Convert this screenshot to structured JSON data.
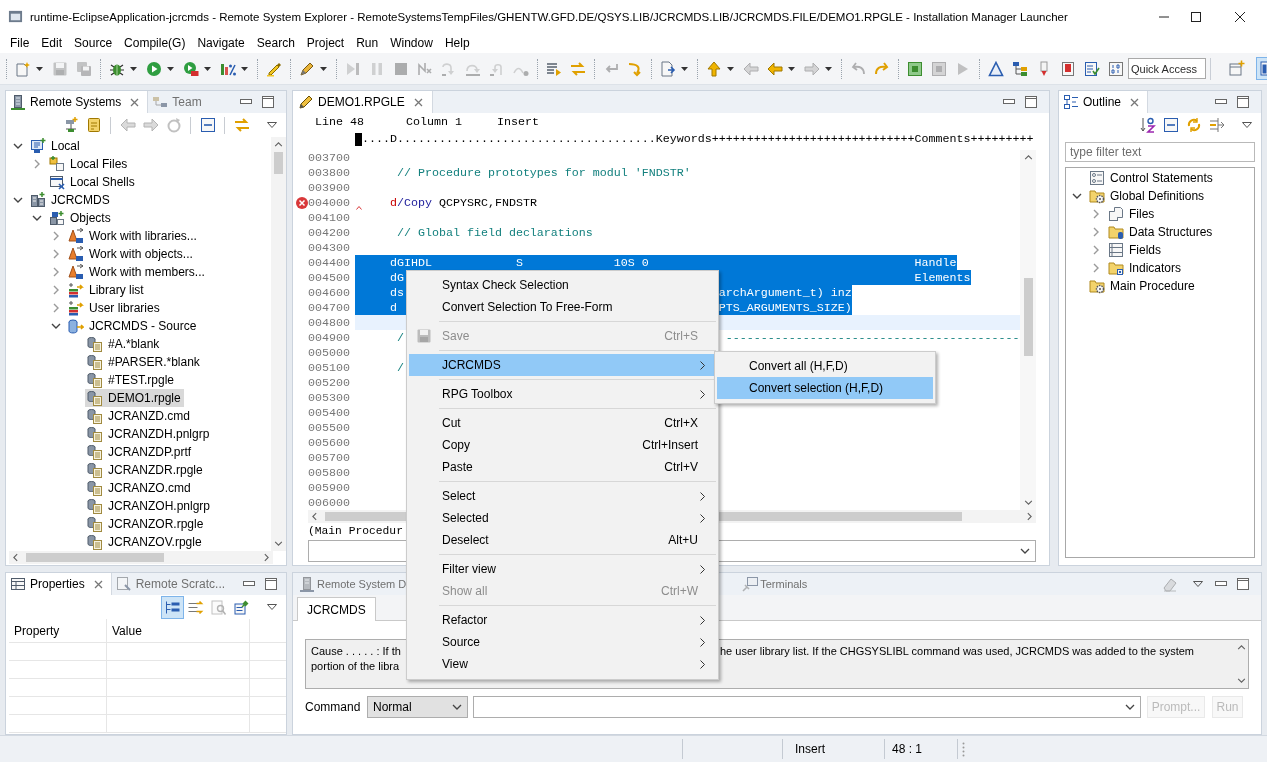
{
  "window": {
    "title": "runtime-EclipseApplication-jcrcmds - Remote System Explorer - RemoteSystemsTempFiles/GHENTW.GFD.DE/QSYS.LIB/JCRCMDS.LIB/JCRCMDS.FILE/DEMO1.RPGLE - Installation Manager Launcher"
  },
  "menu_bar": [
    "File",
    "Edit",
    "Source",
    "Compile(G)",
    "Navigate",
    "Search",
    "Project",
    "Run",
    "Window",
    "Help"
  ],
  "toolbar": {
    "groups": [
      [
        {
          "kind": "new",
          "disabled": false,
          "dropdown": true
        },
        {
          "kind": "floppy",
          "disabled": true,
          "dropdown": false
        },
        {
          "kind": "floppies",
          "disabled": true,
          "dropdown": false
        }
      ],
      [
        {
          "kind": "bug",
          "disabled": false,
          "dropdown": true
        },
        {
          "kind": "run",
          "disabled": false,
          "dropdown": true
        },
        {
          "kind": "external",
          "disabled": false,
          "dropdown": true
        },
        {
          "kind": "coverage",
          "disabled": false,
          "dropdown": true
        }
      ],
      [
        {
          "kind": "highlighter",
          "disabled": false,
          "dropdown": false
        }
      ],
      [
        {
          "kind": "pen",
          "disabled": false,
          "dropdown": true
        }
      ],
      [
        {
          "kind": "resume",
          "disabled": true,
          "dropdown": false
        },
        {
          "kind": "suspend",
          "disabled": true,
          "dropdown": false
        },
        {
          "kind": "terminate",
          "disabled": true,
          "dropdown": false
        },
        {
          "kind": "disconnect",
          "disabled": true,
          "dropdown": false
        },
        {
          "kind": "step-into",
          "disabled": true,
          "dropdown": false
        },
        {
          "kind": "step-over",
          "disabled": true,
          "dropdown": false
        },
        {
          "kind": "step-return",
          "disabled": true,
          "dropdown": false
        },
        {
          "kind": "step-filter",
          "disabled": true,
          "dropdown": false
        }
      ],
      [
        {
          "kind": "lines",
          "disabled": false,
          "dropdown": false
        },
        {
          "kind": "swap",
          "disabled": false,
          "dropdown": false
        }
      ],
      [
        {
          "kind": "return",
          "disabled": true,
          "dropdown": false
        },
        {
          "kind": "curve",
          "disabled": false,
          "dropdown": false
        }
      ],
      [
        {
          "kind": "doc-arrow",
          "disabled": false,
          "dropdown": true
        }
      ],
      [
        {
          "kind": "up",
          "disabled": false,
          "dropdown": true
        },
        {
          "kind": "back",
          "disabled": true,
          "dropdown": false
        },
        {
          "kind": "left",
          "disabled": false,
          "dropdown": true
        },
        {
          "kind": "right",
          "disabled": true,
          "dropdown": true
        }
      ],
      [
        {
          "kind": "undo",
          "disabled": true,
          "dropdown": false
        },
        {
          "kind": "redo",
          "disabled": false,
          "dropdown": false
        }
      ],
      [
        {
          "kind": "square-dot",
          "disabled": false,
          "dropdown": false
        },
        {
          "kind": "square",
          "disabled": true,
          "dropdown": false
        },
        {
          "kind": "play",
          "disabled": true,
          "dropdown": false
        }
      ],
      [
        {
          "kind": "triangle",
          "disabled": false,
          "dropdown": false
        },
        {
          "kind": "hierarchy",
          "disabled": false,
          "dropdown": false
        },
        {
          "kind": "marker",
          "disabled": false,
          "dropdown": false
        },
        {
          "kind": "flag-doc",
          "disabled": false,
          "dropdown": false
        },
        {
          "kind": "checklist",
          "disabled": false,
          "dropdown": false
        },
        {
          "kind": "binary",
          "disabled": false,
          "dropdown": false
        }
      ]
    ],
    "quick_access": {
      "placeholder": "Quick Access"
    },
    "perspectives": [
      {
        "kind": "open-perspective",
        "selected": false
      },
      {
        "kind": "rse-perspective",
        "selected": true
      }
    ]
  },
  "remote_systems": {
    "tabs": [
      {
        "label": "Remote Systems",
        "kind": "remote-systems",
        "selected": true
      },
      {
        "label": "Team",
        "kind": "team",
        "selected": false
      }
    ],
    "toolbar": [
      {
        "kind": "new-connection",
        "disabled": false
      },
      {
        "kind": "clipboard",
        "disabled": false
      },
      {
        "kind": "separator"
      },
      {
        "kind": "back",
        "disabled": true
      },
      {
        "kind": "right",
        "disabled": true
      },
      {
        "kind": "refresh",
        "disabled": true
      },
      {
        "kind": "separator"
      },
      {
        "kind": "collapse-all",
        "disabled": false
      },
      {
        "kind": "separator"
      },
      {
        "kind": "swap",
        "disabled": false
      }
    ],
    "tree": [
      {
        "label": "Local",
        "kind": "host",
        "expanded": true,
        "selected": false,
        "children": [
          {
            "label": "Local Files",
            "kind": "local-files",
            "expanded": false,
            "selected": false
          },
          {
            "label": "Local Shells",
            "kind": "local-shells",
            "selected": false
          }
        ]
      },
      {
        "label": "JCRCMDS",
        "kind": "system",
        "expanded": true,
        "selected": false,
        "children": [
          {
            "label": "Objects",
            "kind": "objects",
            "expanded": true,
            "selected": false,
            "children": [
              {
                "label": "Work with libraries...",
                "kind": "filter",
                "expanded": false,
                "selected": false
              },
              {
                "label": "Work with objects...",
                "kind": "filter",
                "expanded": false,
                "selected": false
              },
              {
                "label": "Work with members...",
                "kind": "filter",
                "expanded": false,
                "selected": false
              },
              {
                "label": "Library list",
                "kind": "library-list",
                "expanded": false,
                "selected": false
              },
              {
                "label": "User libraries",
                "kind": "library-list",
                "expanded": false,
                "selected": false
              },
              {
                "label": "JCRCMDS - Source",
                "kind": "source-file",
                "expanded": true,
                "selected": false,
                "children": [
                  {
                    "label": "#A.*blank",
                    "kind": "member",
                    "selected": false
                  },
                  {
                    "label": "#PARSER.*blank",
                    "kind": "member",
                    "selected": false
                  },
                  {
                    "label": "#TEST.rpgle",
                    "kind": "member",
                    "selected": false
                  },
                  {
                    "label": "DEMO1.rpgle",
                    "kind": "member",
                    "selected": true
                  },
                  {
                    "label": "JCRANZD.cmd",
                    "kind": "member",
                    "selected": false
                  },
                  {
                    "label": "JCRANZDH.pnlgrp",
                    "kind": "member",
                    "selected": false
                  },
                  {
                    "label": "JCRANZDP.prtf",
                    "kind": "member",
                    "selected": false
                  },
                  {
                    "label": "JCRANZDR.rpgle",
                    "kind": "member",
                    "selected": false
                  },
                  {
                    "label": "JCRANZO.cmd",
                    "kind": "member",
                    "selected": false
                  },
                  {
                    "label": "JCRANZOH.pnlgrp",
                    "kind": "member",
                    "selected": false
                  },
                  {
                    "label": "JCRANZOR.rpgle",
                    "kind": "member",
                    "selected": false
                  },
                  {
                    "label": "JCRANZOV.rpgle",
                    "kind": "member",
                    "selected": false
                  }
                ]
              }
            ]
          }
        ]
      }
    ]
  },
  "editor": {
    "tabs": [
      {
        "label": "DEMO1.RPGLE",
        "kind": "editor",
        "selected": true
      }
    ],
    "status": [
      "Line 48",
      "Column 1",
      "Insert"
    ],
    "ruler": {
      "cursor": true,
      "text": "....D.....................................Keywords+++++++++++++++++++++++++++++Comments+++++++++"
    },
    "lines": [
      {
        "number": "003700",
        "selected": false,
        "current": false,
        "error": false
      },
      {
        "number": "003800",
        "selected": false,
        "current": false,
        "error": false,
        "segments": [
          [
            {
              "text": "      // Procedure prototypes for modul 'FNDSTR'",
              "kind": "comment"
            }
          ]
        ]
      },
      {
        "number": "003900",
        "selected": false,
        "current": false,
        "error": false
      },
      {
        "number": "004000",
        "selected": false,
        "current": false,
        "error": true,
        "segments": [
          [
            {
              "text": "     d",
              "kind": "spec"
            },
            {
              "text": "/Copy",
              "kind": "keyword"
            },
            {
              "text": " QCPYSRC,FNDSTR",
              "kind": "plain"
            }
          ]
        ]
      },
      {
        "number": "004100",
        "selected": false,
        "current": false,
        "error": false
      },
      {
        "number": "004200",
        "selected": false,
        "current": false,
        "error": false,
        "segments": [
          [
            {
              "text": "      // Global field declarations",
              "kind": "comment"
            }
          ]
        ]
      },
      {
        "number": "004300",
        "selected": false,
        "current": false,
        "error": false
      },
      {
        "number": "004400",
        "selected": true,
        "current": false,
        "error": false,
        "segments": [
          [
            {
              "text": "     dGIHDL            S             10S 0                                      Handle"
            }
          ]
        ]
      },
      {
        "number": "004500",
        "selected": true,
        "current": false,
        "error": false,
        "segments": [
          [
            {
              "text": "     dG"
            }
          ],
          [
            {
              "text": "                                                                         Elements"
            }
          ]
        ]
      },
      {
        "number": "004600",
        "selected": true,
        "current": false,
        "error": false,
        "segments": [
          [
            {
              "text": "     ds"
            }
          ],
          [
            {
              "text": "                                             archArgument_t) inz"
            }
          ]
        ]
      },
      {
        "number": "004700",
        "selected": true,
        "current": false,
        "error": false,
        "segments": [
          [
            {
              "text": "     d"
            }
          ],
          [
            {
              "text": "                                              PTS_ARGUMENTS_SIZE)"
            }
          ]
        ]
      },
      {
        "number": "004800",
        "selected": false,
        "current": true,
        "error": false
      },
      {
        "number": "004900",
        "selected": false,
        "current": false,
        "error": false,
        "segments": [
          [
            {
              "text": "      /",
              "kind": "comment"
            }
          ],
          [
            {
              "text": "                                              ------------------------------------------",
              "kind": "comment"
            }
          ]
        ]
      },
      {
        "number": "005000",
        "selected": false,
        "current": false,
        "error": false
      },
      {
        "number": "005100",
        "selected": false,
        "current": false,
        "error": false,
        "segments": [
          [
            {
              "text": "      /",
              "kind": "comment"
            }
          ]
        ]
      },
      {
        "number": "005200",
        "selected": false,
        "current": false,
        "error": false
      },
      {
        "number": "005300",
        "selected": false,
        "current": false,
        "error": false
      },
      {
        "number": "005400",
        "selected": false,
        "current": false,
        "error": false
      },
      {
        "number": "005500",
        "selected": false,
        "current": false,
        "error": false
      },
      {
        "number": "005600",
        "selected": false,
        "current": false,
        "error": false
      },
      {
        "number": "005700",
        "selected": false,
        "current": false,
        "error": false
      },
      {
        "number": "005800",
        "selected": false,
        "current": false,
        "error": false
      },
      {
        "number": "005900",
        "selected": false,
        "current": false,
        "error": false
      },
      {
        "number": "006000",
        "selected": false,
        "current": false,
        "error": false
      }
    ],
    "procedure": "(Main Procedur"
  },
  "outline": {
    "tabs": [
      {
        "label": "Outline",
        "kind": "outline",
        "selected": true
      }
    ],
    "toolbar": [
      {
        "kind": "sort-az",
        "disabled": false
      },
      {
        "kind": "collapse-all",
        "disabled": false
      },
      {
        "kind": "sync",
        "disabled": false
      },
      {
        "kind": "merge",
        "disabled": false
      }
    ],
    "filter": {
      "placeholder": "type filter text"
    },
    "tree": [
      {
        "label": "Control Statements",
        "kind": "control-statements",
        "selected": false
      },
      {
        "label": "Global Definitions",
        "kind": "folder-gear",
        "expanded": true,
        "selected": false,
        "children": [
          {
            "label": "Files",
            "kind": "files",
            "expanded": false,
            "selected": false
          },
          {
            "label": "Data Structures",
            "kind": "folder-cylinder",
            "expanded": false,
            "selected": false
          },
          {
            "label": "Fields",
            "kind": "fields",
            "expanded": false,
            "selected": false
          },
          {
            "label": "Indicators",
            "kind": "folder-indicator",
            "expanded": false,
            "selected": false
          }
        ]
      },
      {
        "label": "Main Procedure",
        "kind": "folder-gear",
        "selected": false
      }
    ]
  },
  "properties": {
    "tabs": [
      {
        "label": "Properties",
        "kind": "properties",
        "selected": true
      },
      {
        "label": "Remote Scratc...",
        "kind": "scratchpad",
        "selected": false
      }
    ],
    "toolbar": [
      {
        "kind": "tree-list",
        "selected": true,
        "disabled": false
      },
      {
        "kind": "arrows",
        "selected": false,
        "disabled": false
      },
      {
        "kind": "doc-search",
        "selected": false,
        "disabled": true
      },
      {
        "kind": "pin-doc",
        "selected": false,
        "disabled": false
      }
    ],
    "columns": [
      "Property",
      "Value"
    ]
  },
  "console": {
    "tabs": [
      {
        "label": "Remote System D",
        "kind": "system-details",
        "selected": false
      },
      {
        "label": "Terminals",
        "kind": "terminals",
        "selected": false
      }
    ],
    "toolbar": [
      {
        "kind": "eraser",
        "disabled": true
      }
    ],
    "subtabs": [
      {
        "label": "JCRCMDS",
        "selected": true
      }
    ],
    "message": {
      "lines": [
        [
          "Cause . . . . . : If th",
          "he user library list. If the CHGSYSLIBL command was used, JCRCMDS was added to the system"
        ],
        [
          "portion of the libra"
        ]
      ]
    },
    "command": {
      "label": "Command",
      "mode": "Normal",
      "buttons": [
        {
          "label": "Prompt...",
          "disabled": true
        },
        {
          "label": "Run",
          "disabled": true
        }
      ]
    }
  },
  "status_bar": {
    "fields": [
      "Insert",
      "48 : 1"
    ]
  },
  "context_menu": {
    "items": [
      {
        "kind": "item",
        "label": "Syntax Check Selection",
        "disabled": false,
        "selected": false,
        "submenu": false,
        "icon": false
      },
      {
        "kind": "item",
        "label": "Convert Selection To Free-Form",
        "disabled": false,
        "selected": false,
        "submenu": false,
        "icon": false
      },
      {
        "kind": "separator"
      },
      {
        "kind": "item",
        "label": "Save",
        "shortcut": "Ctrl+S",
        "disabled": true,
        "selected": false,
        "submenu": false,
        "icon": true
      },
      {
        "kind": "separator"
      },
      {
        "kind": "item",
        "label": "JCRCMDS",
        "disabled": false,
        "selected": true,
        "submenu": true,
        "icon": false
      },
      {
        "kind": "separator"
      },
      {
        "kind": "item",
        "label": "RPG Toolbox",
        "disabled": false,
        "selected": false,
        "submenu": true,
        "icon": false
      },
      {
        "kind": "separator"
      },
      {
        "kind": "item",
        "label": "Cut",
        "shortcut": "Ctrl+X",
        "disabled": false,
        "selected": false,
        "submenu": false,
        "icon": false
      },
      {
        "kind": "item",
        "label": "Copy",
        "shortcut": "Ctrl+Insert",
        "disabled": false,
        "selected": false,
        "submenu": false,
        "icon": false
      },
      {
        "kind": "item",
        "label": "Paste",
        "shortcut": "Ctrl+V",
        "disabled": false,
        "selected": false,
        "submenu": false,
        "icon": false
      },
      {
        "kind": "separator"
      },
      {
        "kind": "item",
        "label": "Select",
        "disabled": false,
        "selected": false,
        "submenu": true,
        "icon": false
      },
      {
        "kind": "item",
        "label": "Selected",
        "disabled": false,
        "selected": false,
        "submenu": true,
        "icon": false
      },
      {
        "kind": "item",
        "label": "Deselect",
        "shortcut": "Alt+U",
        "disabled": false,
        "selected": false,
        "submenu": false,
        "icon": false
      },
      {
        "kind": "separator"
      },
      {
        "kind": "item",
        "label": "Filter view",
        "disabled": false,
        "selected": false,
        "submenu": true,
        "icon": false
      },
      {
        "kind": "item",
        "label": "Show all",
        "shortcut": "Ctrl+W",
        "disabled": true,
        "selected": false,
        "submenu": false,
        "icon": false
      },
      {
        "kind": "separator"
      },
      {
        "kind": "item",
        "label": "Refactor",
        "disabled": false,
        "selected": false,
        "submenu": true,
        "icon": false
      },
      {
        "kind": "item",
        "label": "Source",
        "disabled": false,
        "selected": false,
        "submenu": true,
        "icon": false
      },
      {
        "kind": "item",
        "label": "View",
        "disabled": false,
        "selected": false,
        "submenu": true,
        "icon": false
      }
    ]
  },
  "submenu": {
    "items": [
      {
        "label": "Convert all (H,F,D)",
        "selected": false
      },
      {
        "label": "Convert selection (H,F,D)",
        "selected": true
      }
    ]
  }
}
